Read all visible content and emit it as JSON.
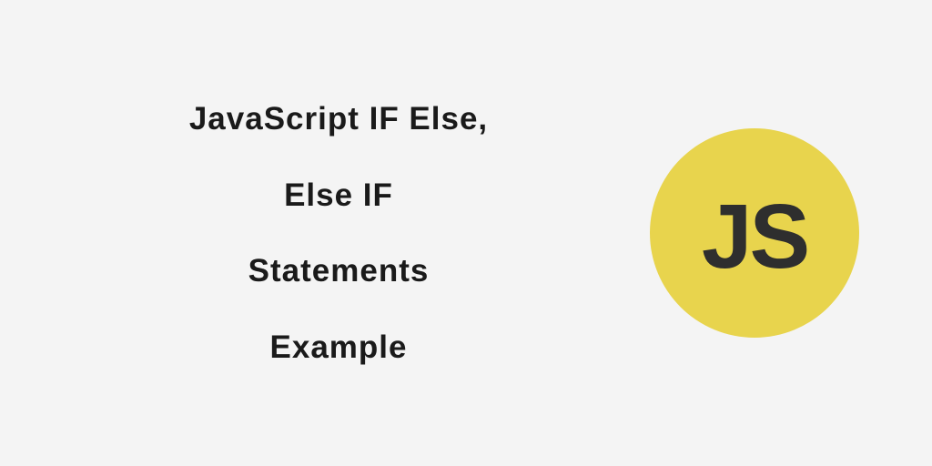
{
  "title": {
    "line1": "JavaScript IF Else,",
    "line2": "Else IF",
    "line3": "Statements",
    "line4": "Example"
  },
  "logo": {
    "text": "JS"
  }
}
